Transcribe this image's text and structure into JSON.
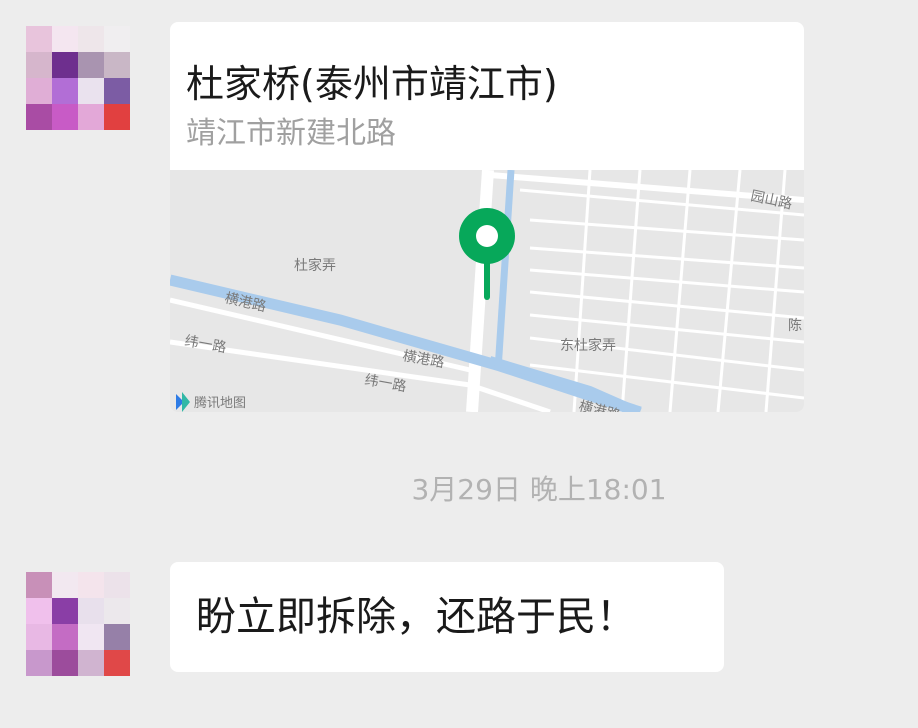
{
  "messages": [
    {
      "type": "location",
      "title": "杜家桥(泰州市靖江市)",
      "address": "靖江市新建北路",
      "map": {
        "provider": "腾讯地图",
        "labels": {
          "dujianong": "杜家弄",
          "hengganglu_1": "横港路",
          "hengganglu_2": "横港路",
          "hengganglu_3": "横港路",
          "weiyilu_1": "纬一路",
          "weiyilu_2": "纬一路",
          "dongdujianong": "东杜家弄",
          "yuanshanlu": "园山路",
          "chen": "陈"
        },
        "pin_color": "#07a85a",
        "water_color": "#a9cbec",
        "road_color": "#ffffff"
      }
    },
    {
      "type": "timestamp",
      "text": "3月29日 晚上18:01"
    },
    {
      "type": "text",
      "text": "盼立即拆除，还路于民！"
    }
  ],
  "avatar_colors": {
    "avatar1": [
      "#e8c4dc",
      "#f4e6f0",
      "#eee6ea",
      "#f0eef0",
      "#d6b6cc",
      "#6e2f8e",
      "#a994b0",
      "#c9b7c6",
      "#e0aed6",
      "#b26ed6",
      "#eae2ee",
      "#7c5ca4",
      "#a94ca4",
      "#c85bc6",
      "#e3a8d8",
      "#e14040"
    ],
    "avatar2": [
      "#c890b8",
      "#f2e8f0",
      "#f4e4ec",
      "#ece2ea",
      "#f0c0ec",
      "#8a3ea6",
      "#e8e0ec",
      "#ece8ec",
      "#e8b8e4",
      "#c46cc4",
      "#f0e6f2",
      "#9680a8",
      "#c898cc",
      "#9c4c9c",
      "#d0b4d0",
      "#e04848"
    ]
  }
}
